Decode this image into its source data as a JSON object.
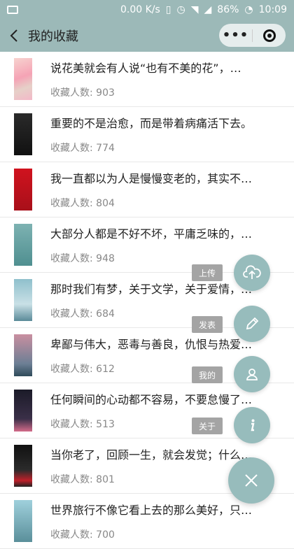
{
  "status_bar": {
    "network_speed": "0.00 K/s",
    "battery": "86%",
    "time": "10:09"
  },
  "nav": {
    "title": "我的收藏",
    "more_label": "•••"
  },
  "count_prefix": "收藏人数: ",
  "items": [
    {
      "title": "说花美就会有人说“也有不美的花”，…",
      "count_text": "收藏人数: 903",
      "cover_color": "#f2c8c8"
    },
    {
      "title": "重要的不是治愈，而是带着病痛活下去。",
      "count_text": "收藏人数: 774",
      "cover_color": "#1e1e1e"
    },
    {
      "title": "我一直都以为人是慢慢变老的，其实不…",
      "count_text": "收藏人数: 804",
      "cover_color": "#c0141e"
    },
    {
      "title": "大部分人都是不好不坏，平庸乏味的，…",
      "count_text": "收藏人数: 948",
      "cover_color": "#6aa3a3"
    },
    {
      "title": "那时我们有梦，关于文学，关于爱情，…",
      "count_text": "收藏人数: 684",
      "cover_color": "#7fb0bd"
    },
    {
      "title": "卑鄙与伟大，恶毒与善良，仇恨与热爱…",
      "count_text": "收藏人数: 612",
      "cover_color": "#b07a8a"
    },
    {
      "title": "任何瞬间的心动都不容易，不要怠慢了…",
      "count_text": "收藏人数: 513",
      "cover_color": "#2a2a3a"
    },
    {
      "title": "当你老了，回顾一生，就会发觉；什么…",
      "count_text": "收藏人数: 801",
      "cover_color": "#1a1a1a"
    },
    {
      "title": "世界旅行不像它看上去的那么美好，只…",
      "count_text": "收藏人数: 700",
      "cover_color": "#7fb5c2"
    }
  ],
  "fab": {
    "upload_label": "上传",
    "post_label": "发表",
    "mine_label": "我的",
    "about_label": "关于",
    "color": "#97bcbc"
  }
}
